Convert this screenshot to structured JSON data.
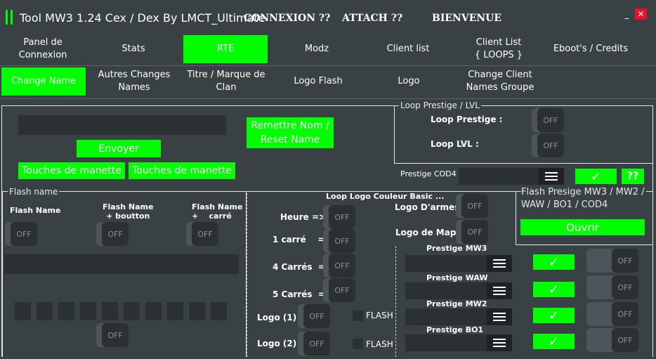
{
  "app": {
    "title": "Tool MW3 1.24 Cex / Dex By LMCT_Ultimate",
    "status_connexion": "CONNEXION ??",
    "status_attach": "ATTACH ??",
    "status_welcome": "BIENVENUE",
    "minimize": "_",
    "close": "✕"
  },
  "colors": {
    "accent": "#00ff00",
    "background": "#3a4145",
    "close": "#e8112d"
  },
  "main_tabs": [
    {
      "label": "Panel de Connexion",
      "active": false
    },
    {
      "label": "Stats",
      "active": false
    },
    {
      "label": "RTE",
      "active": true
    },
    {
      "label": "Modz",
      "active": false
    },
    {
      "label": "Client list",
      "active": false
    },
    {
      "label": "Client List\n{ LOOPS }",
      "active": false
    },
    {
      "label": "Eboot's / Credits",
      "active": false
    }
  ],
  "sub_tabs": [
    {
      "label": "Change Name",
      "active": true
    },
    {
      "label": "Autres Changes Names",
      "active": false
    },
    {
      "label": "Titre / Marque de Clan",
      "active": false
    },
    {
      "label": "Logo Flash",
      "active": false
    },
    {
      "label": "Logo",
      "active": false
    },
    {
      "label": "Change Client Names Groupe",
      "active": false
    }
  ],
  "change_name": {
    "send": "Envoyer",
    "reset": "Remettre Nom / Reset Name",
    "pad_buttons_1": "Touches de manette",
    "pad_buttons_2": "Touches de manette"
  },
  "toggle_off": "OFF",
  "loop_prestige": {
    "title": "Loop Prestige / LVL",
    "prestige_label": "Loop Prestige :",
    "lvl_label": "Loop LVL :",
    "cod4_label": "Prestige COD4",
    "check": "✓",
    "help": "??"
  },
  "flash_name": {
    "title": "Flash name",
    "col1": "Flash Name",
    "col2": "Flash Name\n+ boutton",
    "col3": "Flash Name\n+    carré"
  },
  "loop_logo": {
    "title": "Loop Logo Couleur Basic ...",
    "heure": "Heure =>",
    "un_carre": "1 carré    =>",
    "quatre_carres": "4 Carrés  =>",
    "cinq_carres": "5 Carrés  =>",
    "logo1": "Logo (1) =",
    "logo2": "Logo (2) =",
    "flash": "FLASH",
    "logo_armes": "Logo D'armes =>",
    "logo_map": "Logo de Map =>"
  },
  "flash_presige": {
    "title": "Flash Presige MW3 / MW2 / WAW / BO1 / COD4",
    "open": "Ouvrir"
  },
  "prestige_rows": [
    {
      "label": "Prestige MW3"
    },
    {
      "label": "Prestige WAW"
    },
    {
      "label": "Prestige MW2"
    },
    {
      "label": "Prestige BO1"
    }
  ]
}
